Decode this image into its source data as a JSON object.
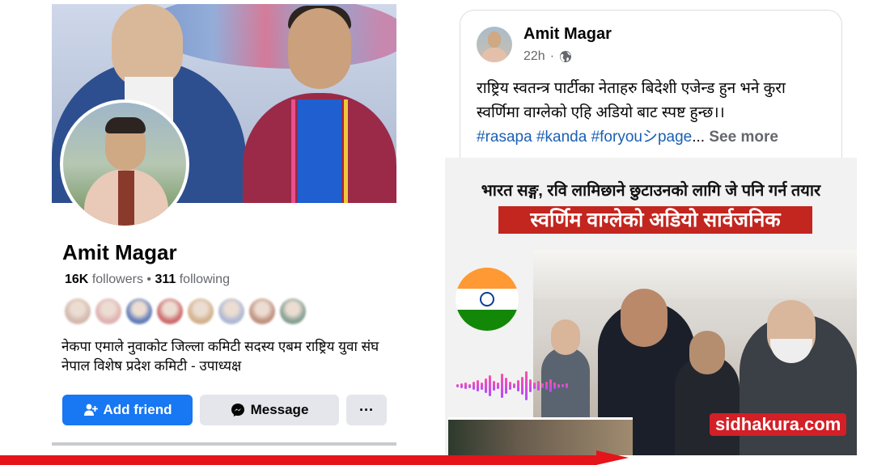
{
  "profile": {
    "name": "Amit Magar",
    "followers_count": "16K",
    "followers_label": "followers",
    "following_count": "311",
    "following_label": "following",
    "bio": "नेकपा एमाले नुवाकोट जिल्ला कमिटी सदस्य एबम राष्ट्रिय युवा संघ नेपाल विशेष प्रदेश  कमिटी - उपाध्यक्ष",
    "friend_avatar_colors": [
      "#c9a89a",
      "#d8a0a0",
      "#3d5fa8",
      "#c24a4a",
      "#c8a070",
      "#9aa8c8",
      "#b07860",
      "#6a8a7a"
    ],
    "buttons": {
      "add_friend": "Add friend",
      "message": "Message",
      "more": "···"
    }
  },
  "post": {
    "author": "Amit Magar",
    "time": "22h",
    "text": "राष्ट्रिय स्वतन्त्र पार्टीका नेताहरु बिदेशी  एजेन्ड हुन भने कुरा स्वर्णिमा वाग्लेको एहि अडियो बाट स्पष्ट हुन्छ।।",
    "hashtags": [
      "#rasapa",
      "#kanda",
      "#foryouシpage"
    ],
    "ellipsis": "...",
    "see_more": "See more",
    "image": {
      "headline_1": "भारत सङ्ग, रवि लामिछाने छुटाउनको लागि जे पनि गर्न तयार",
      "headline_2": "स्वर्णिम वाग्लेको अडियो सार्वजनिक"
    }
  },
  "watermark": "sidhakura.com",
  "colors": {
    "facebook_blue": "#1877f2",
    "headline_red": "#c2261f",
    "watermark_red": "#d31f26",
    "bar_red": "#e5141a"
  },
  "icons": {
    "add_friend": "person-plus-icon",
    "message": "messenger-icon",
    "audience": "globe-icon"
  }
}
